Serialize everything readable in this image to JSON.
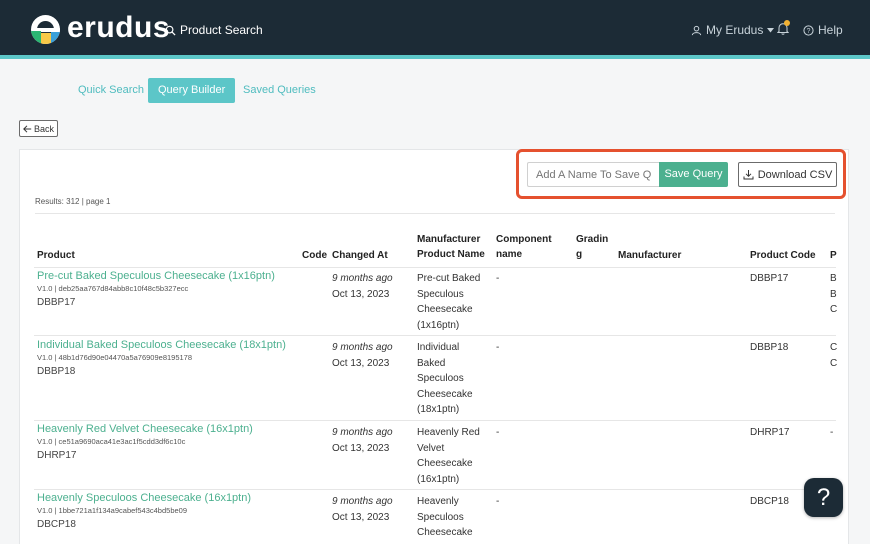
{
  "header": {
    "brand": "erudus",
    "search_label": "Product Search",
    "my_label": "My Erudus",
    "help_label": "Help"
  },
  "tabs": [
    {
      "label": "Quick Search",
      "active": false
    },
    {
      "label": "Query Builder",
      "active": true
    },
    {
      "label": "Saved Queries",
      "active": false
    }
  ],
  "back_label": "Back",
  "results_text": "Results: 312 | page 1",
  "save_query": {
    "placeholder": "Add A Name To Save Query",
    "button": "Save Query"
  },
  "download_label": "Download CSV",
  "columns": {
    "product": "Product",
    "code": "Code",
    "changed": "Changed At",
    "mfr_name_1": "Manufacturer",
    "mfr_name_2": "Product Name",
    "component_1": "Component",
    "component_2": "name",
    "grading_1": "Gradin",
    "grading_2": "g",
    "manufacturer": "Manufacturer",
    "product_code": "Product Code",
    "p": "P"
  },
  "rows": [
    {
      "name": "Pre-cut Baked Speculous Cheesecake (1x16ptn)",
      "meta": "V1.0 | deb25aa767d84abb8c10f48c5b327ecc",
      "code": "DBBP17",
      "ago": "9 months ago",
      "date": "Oct 13, 2023",
      "mfr_lines": [
        "Pre-cut Baked",
        "Speculous",
        "Cheesecake",
        "(1x16ptn)"
      ],
      "component": "-",
      "product_code": "DBBP17",
      "p": [
        "B",
        "B",
        "C"
      ]
    },
    {
      "name": "Individual Baked Speculoos Cheesecake (18x1ptn)",
      "meta": "V1.0 | 48b1d76d90e04470a5a76909e8195178",
      "code": "DBBP18",
      "ago": "9 months ago",
      "date": "Oct 13, 2023",
      "mfr_lines": [
        "Individual",
        "Baked",
        "Speculoos",
        "Cheesecake",
        "(18x1ptn)"
      ],
      "component": "-",
      "product_code": "DBBP18",
      "p": [
        "C",
        "C"
      ]
    },
    {
      "name": "Heavenly Red Velvet Cheesecake (16x1ptn)",
      "meta": "V1.0 | ce51a9690aca41e3ac1f5cdd3df6c10c",
      "code": "DHRP17",
      "ago": "9 months ago",
      "date": "Oct 13, 2023",
      "mfr_lines": [
        "Heavenly Red",
        "Velvet",
        "Cheesecake",
        "(16x1ptn)"
      ],
      "component": "-",
      "product_code": "DHRP17",
      "p": [
        "-"
      ]
    },
    {
      "name": "Heavenly Speculoos Cheesecake (16x1ptn)",
      "meta": "V1.0 | 1bbe721a1f134a9cabef543c4bd5be09",
      "code": "DBCP18",
      "ago": "9 months ago",
      "date": "Oct 13, 2023",
      "mfr_lines": [
        "Heavenly",
        "Speculoos",
        "Cheesecake"
      ],
      "component": "-",
      "product_code": "DBCP18",
      "p": []
    }
  ],
  "help_fab": "?"
}
